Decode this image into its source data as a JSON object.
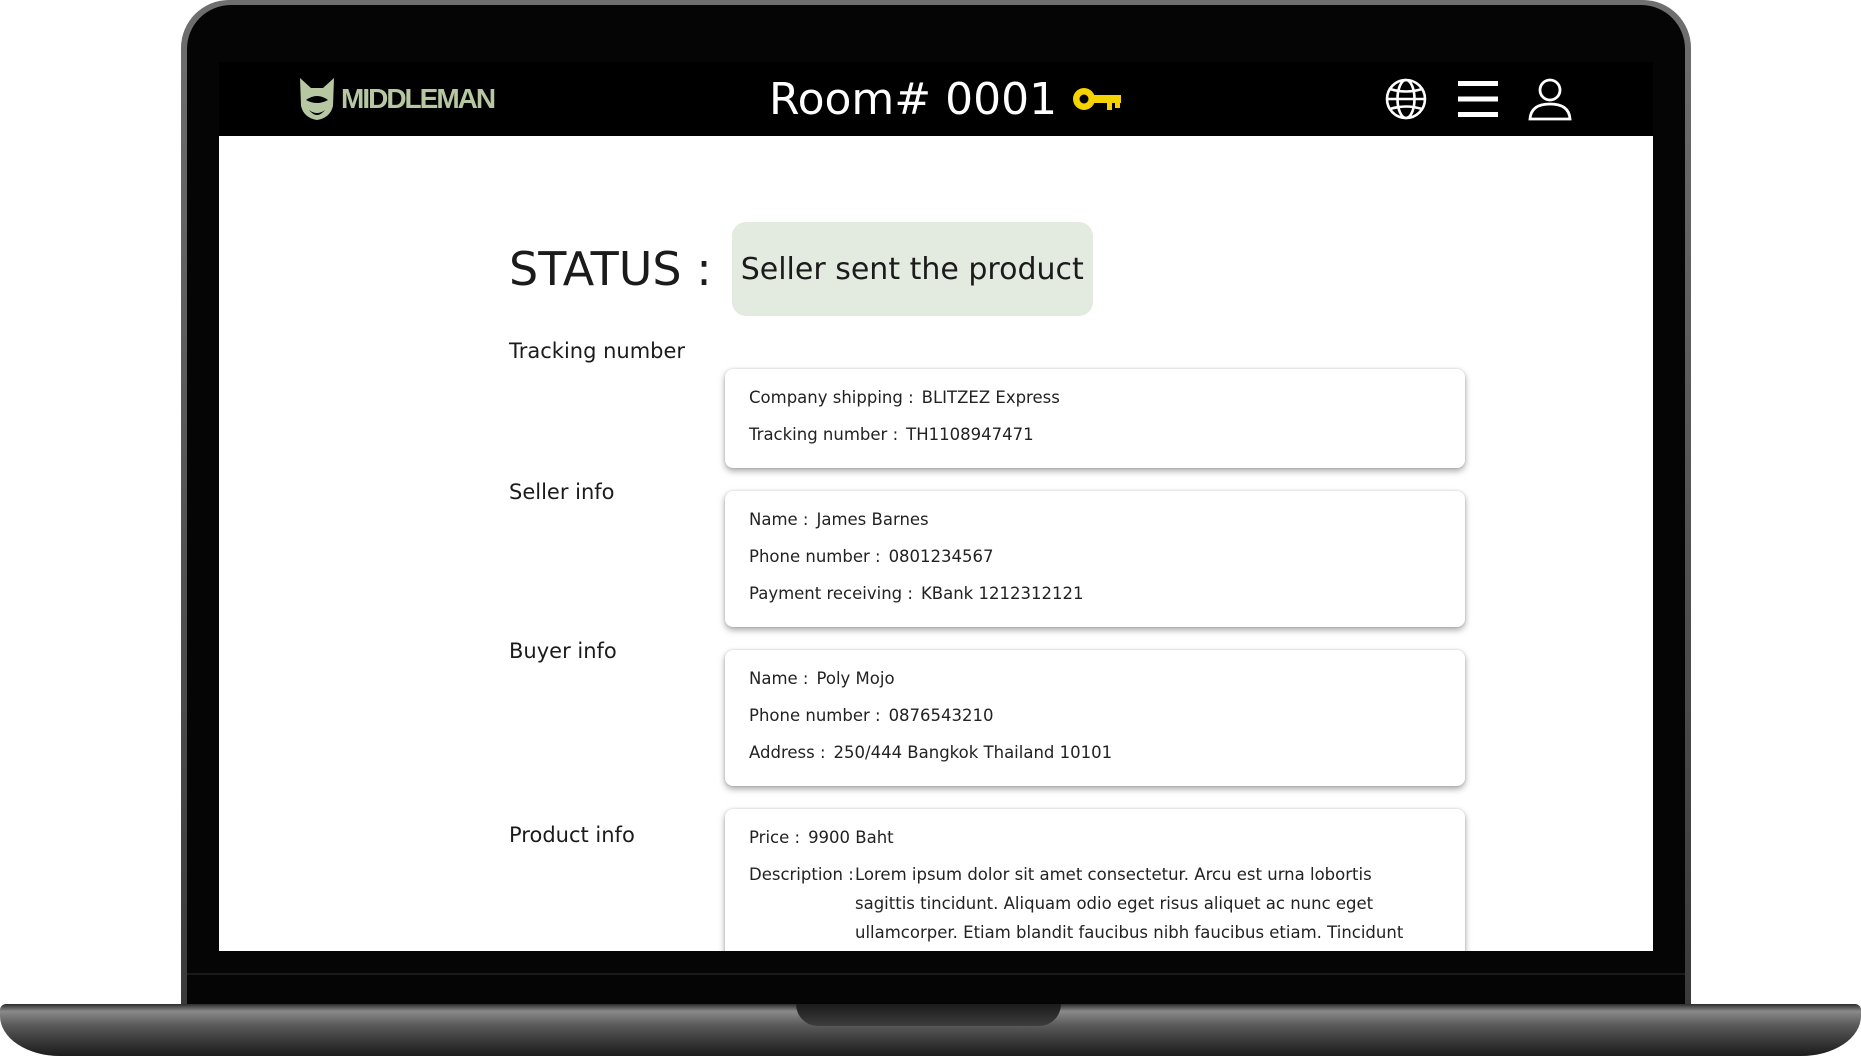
{
  "brand": {
    "name": "MIDDLEMAN",
    "color": "#b7c7a2"
  },
  "header": {
    "room_title": "Room# 0001",
    "key_icon_color": "#f5d300",
    "icons": [
      "globe-icon",
      "menu-icon",
      "user-icon"
    ]
  },
  "status": {
    "label": "STATUS :",
    "value": "Seller sent the product",
    "badge_color": "#e3ebe1"
  },
  "tracking": {
    "label": "Tracking number",
    "company_key": "Company shipping :",
    "company_value": "BLITZEZ Express",
    "number_key": "Tracking number :",
    "number_value": "TH1108947471"
  },
  "seller": {
    "label": "Seller info",
    "name_key": "Name :",
    "name_value": "James Barnes",
    "phone_key": "Phone number :",
    "phone_value": "0801234567",
    "payment_key": "Payment receiving :",
    "payment_value": "KBank 1212312121"
  },
  "buyer": {
    "label": "Buyer info",
    "name_key": "Name :",
    "name_value": "Poly Mojo",
    "phone_key": "Phone number :",
    "phone_value": "0876543210",
    "address_key": "Address :",
    "address_value": "250/444 Bangkok Thailand 10101"
  },
  "product": {
    "label": "Product info",
    "price_key": "Price :",
    "price_value": "9900  Baht",
    "description_key": "Description :",
    "description_value": "Lorem ipsum dolor sit amet consectetur. Arcu est urna lobortis sagittis tincidunt. Aliquam odio eget risus aliquet ac nunc eget ullamcorper. Etiam blandit faucibus nibh faucibus etiam. Tincidunt cras urna magna aliquam"
  }
}
